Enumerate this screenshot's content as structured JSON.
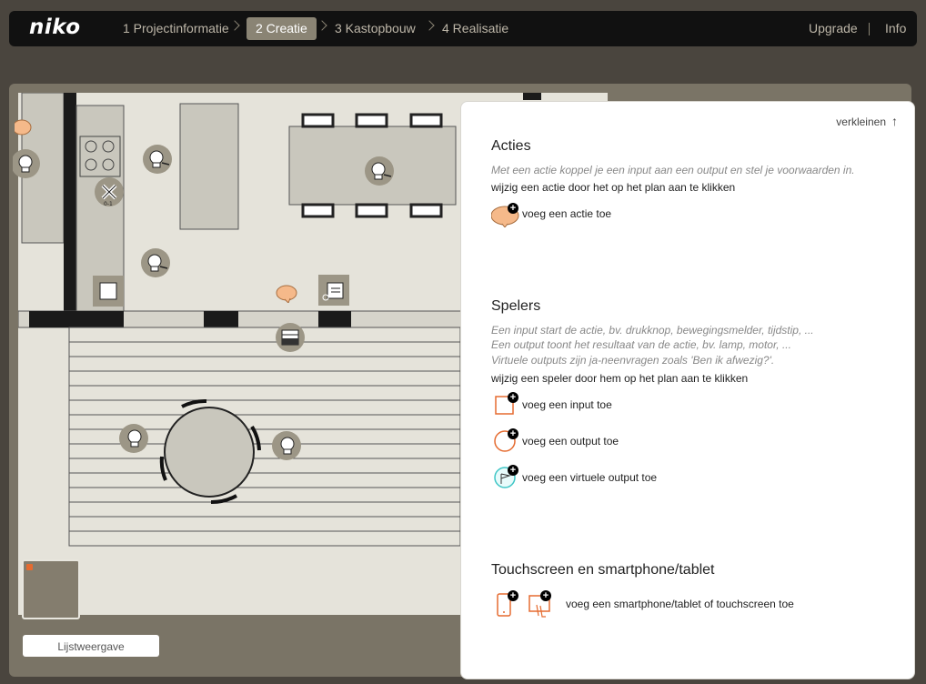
{
  "nav": {
    "logo": "niko",
    "steps": [
      {
        "label": "1 Projectinformatie"
      },
      {
        "label": "2 Creatie"
      },
      {
        "label": "3 Kastopbouw"
      },
      {
        "label": "4 Realisatie"
      }
    ],
    "links": [
      "Upgrade",
      "Info"
    ]
  },
  "plan": {
    "list_view_label": "Lijstweergave"
  },
  "panel": {
    "collapse_label": "verkleinen",
    "acties": {
      "title": "Acties",
      "description": "Met een actie koppel je een input aan een output en stel je voorwaarden in.",
      "instruction": "wijzig een actie door het op het plan aan te klikken",
      "add_label": "voeg een actie toe"
    },
    "spelers": {
      "title": "Spelers",
      "desc_lines": [
        "Een input start de actie, bv. drukknop, bewegingsmelder, tijdstip, ...",
        "Een output toont het resultaat van de actie, bv. lamp, motor, ...",
        "Virtuele outputs zijn ja-neenvragen zoals 'Ben ik afwezig?'."
      ],
      "instruction": "wijzig een speler door hem op het plan aan te klikken",
      "add_input": "voeg een input toe",
      "add_output": "voeg een output toe",
      "add_virtual": "voeg een virtuele output toe"
    },
    "touch": {
      "title": "Touchscreen en smartphone/tablet",
      "add_label": "voeg een smartphone/tablet of touchscreen toe"
    }
  },
  "colors": {
    "accent": "#e56b30",
    "speech": "#f5b98a",
    "virtual": "#3fc6c6",
    "nav_active": "#8a8474"
  }
}
